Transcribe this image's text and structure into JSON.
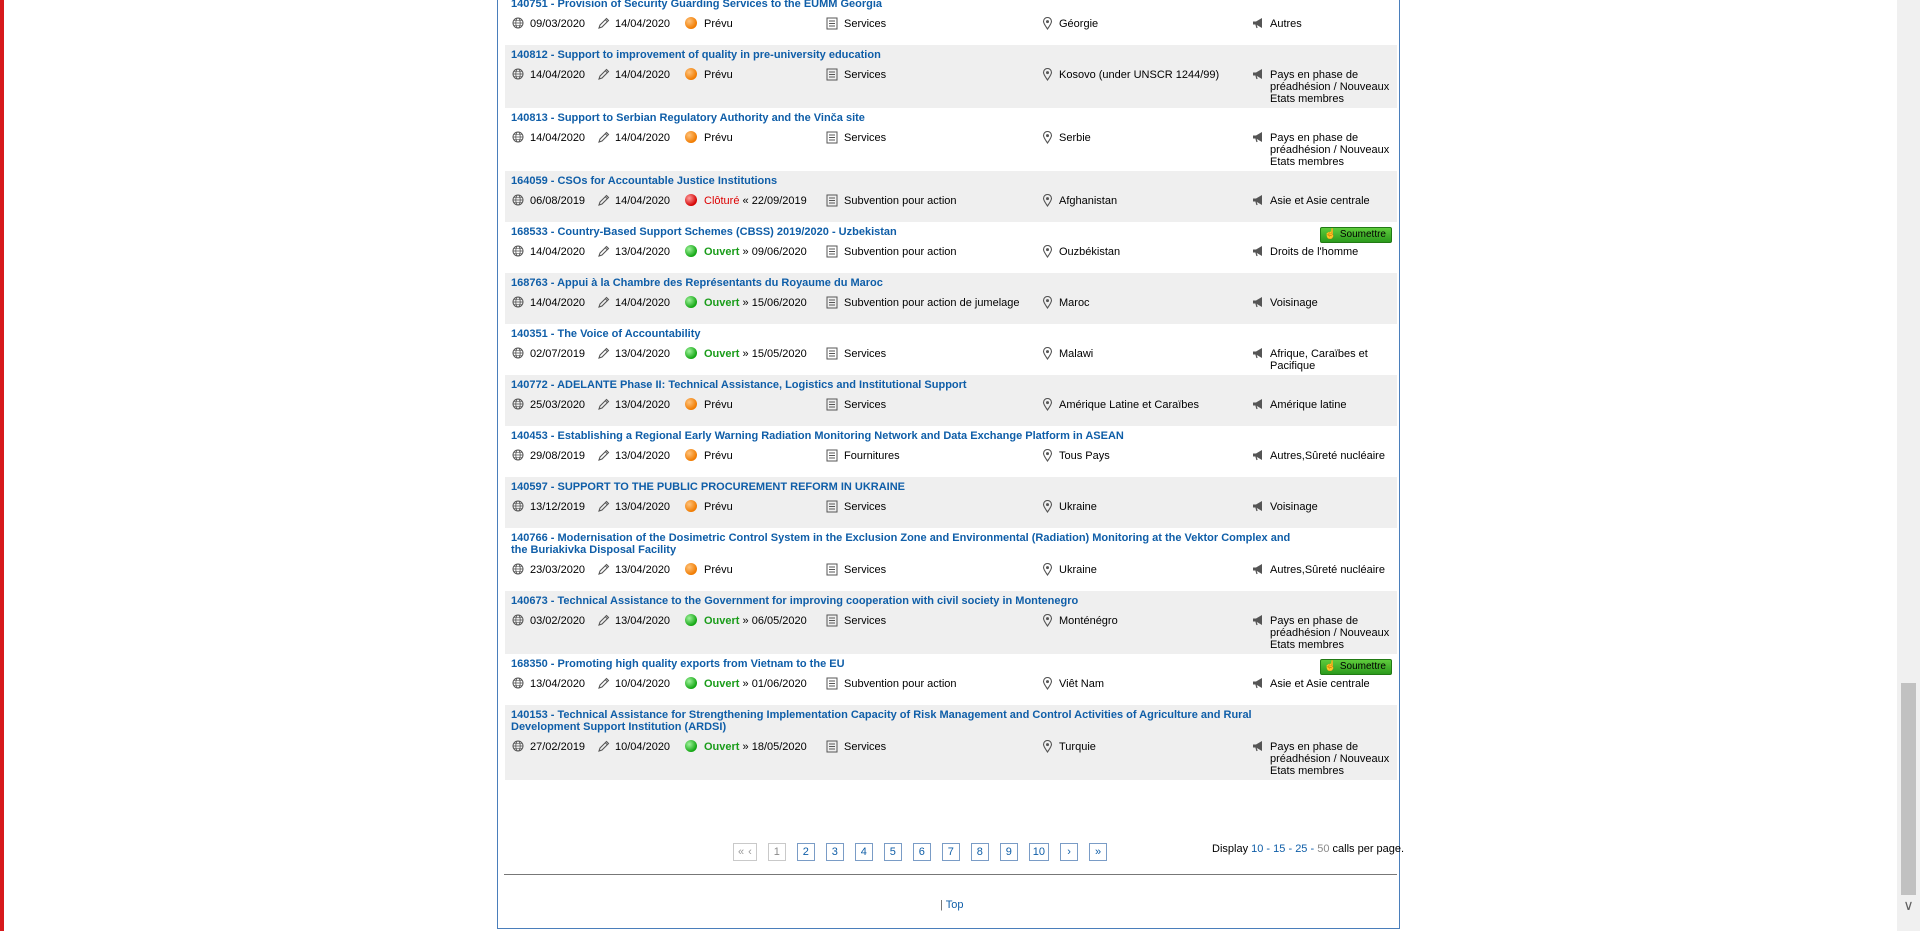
{
  "results": [
    {
      "title": "140751 - Provision of Security Guarding Services to the EUMM Georgia",
      "published": "09/03/2020",
      "modified": "14/04/2020",
      "status": "Prévu",
      "status_kind": "prevu",
      "deadline_prefix": "",
      "deadline": "",
      "type": "Services",
      "country": "Géorgie",
      "region": "Autres",
      "submit": ""
    },
    {
      "title": "140812 - Support to improvement of quality in pre-university education",
      "published": "14/04/2020",
      "modified": "14/04/2020",
      "status": "Prévu",
      "status_kind": "prevu",
      "deadline_prefix": "",
      "deadline": "",
      "type": "Services",
      "country": "Kosovo (under UNSCR 1244/99)",
      "region": "Pays en phase de préadhésion / Nouveaux Etats membres",
      "submit": ""
    },
    {
      "title": "140813 - Support to Serbian Regulatory Authority and the Vinča site",
      "published": "14/04/2020",
      "modified": "14/04/2020",
      "status": "Prévu",
      "status_kind": "prevu",
      "deadline_prefix": "",
      "deadline": "",
      "type": "Services",
      "country": "Serbie",
      "region": "Pays en phase de préadhésion / Nouveaux Etats membres",
      "submit": ""
    },
    {
      "title": "164059 - CSOs for Accountable Justice Institutions",
      "published": "06/08/2019",
      "modified": "14/04/2020",
      "status": "Clôturé",
      "status_kind": "cloture",
      "deadline_prefix": "«",
      "deadline": "22/09/2019",
      "type": "Subvention pour action",
      "country": "Afghanistan",
      "region": "Asie et Asie centrale",
      "submit": ""
    },
    {
      "title": "168533 - Country-Based Support Schemes (CBSS) 2019/2020 - Uzbekistan",
      "published": "14/04/2020",
      "modified": "13/04/2020",
      "status": "Ouvert",
      "status_kind": "ouvert",
      "deadline_prefix": "»",
      "deadline": "09/06/2020",
      "type": "Subvention pour action",
      "country": "Ouzbékistan",
      "region": "Droits de l'homme",
      "submit": "Soumettre"
    },
    {
      "title": "168763 - Appui à la Chambre des Représentants du Royaume du Maroc",
      "published": "14/04/2020",
      "modified": "14/04/2020",
      "status": "Ouvert",
      "status_kind": "ouvert",
      "deadline_prefix": "»",
      "deadline": "15/06/2020",
      "type": "Subvention pour action de jumelage",
      "country": "Maroc",
      "region": "Voisinage",
      "submit": ""
    },
    {
      "title": "140351 - The Voice of Accountability",
      "published": "02/07/2019",
      "modified": "13/04/2020",
      "status": "Ouvert",
      "status_kind": "ouvert",
      "deadline_prefix": "»",
      "deadline": "15/05/2020",
      "type": "Services",
      "country": "Malawi",
      "region": "Afrique, Caraïbes et Pacifique",
      "submit": ""
    },
    {
      "title": "140772 - ADELANTE Phase II: Technical Assistance, Logistics and Institutional Support",
      "published": "25/03/2020",
      "modified": "13/04/2020",
      "status": "Prévu",
      "status_kind": "prevu",
      "deadline_prefix": "",
      "deadline": "",
      "type": "Services",
      "country": "Amérique Latine et Caraïbes",
      "region": "Amérique latine",
      "submit": ""
    },
    {
      "title": "140453 - Establishing a Regional Early Warning Radiation Monitoring Network and Data Exchange Platform in ASEAN",
      "published": "29/08/2019",
      "modified": "13/04/2020",
      "status": "Prévu",
      "status_kind": "prevu",
      "deadline_prefix": "",
      "deadline": "",
      "type": "Fournitures",
      "country": "Tous Pays",
      "region": "Autres,Sûreté nucléaire",
      "submit": ""
    },
    {
      "title": "140597 - SUPPORT TO THE PUBLIC PROCUREMENT REFORM IN UKRAINE",
      "published": "13/12/2019",
      "modified": "13/04/2020",
      "status": "Prévu",
      "status_kind": "prevu",
      "deadline_prefix": "",
      "deadline": "",
      "type": "Services",
      "country": "Ukraine",
      "region": "Voisinage",
      "submit": ""
    },
    {
      "title": "140766 - Modernisation of the Dosimetric Control System in the Exclusion Zone and Environmental (Radiation) Monitoring at the Vektor Complex and the Buriakivka Disposal Facility",
      "published": "23/03/2020",
      "modified": "13/04/2020",
      "status": "Prévu",
      "status_kind": "prevu",
      "deadline_prefix": "",
      "deadline": "",
      "type": "Services",
      "country": "Ukraine",
      "region": "Autres,Sûreté nucléaire",
      "submit": ""
    },
    {
      "title": "140673 - Technical Assistance to the Government for improving cooperation with civil society in Montenegro",
      "published": "03/02/2020",
      "modified": "13/04/2020",
      "status": "Ouvert",
      "status_kind": "ouvert",
      "deadline_prefix": "»",
      "deadline": "06/05/2020",
      "type": "Services",
      "country": "Monténégro",
      "region": "Pays en phase de préadhésion / Nouveaux Etats membres",
      "submit": ""
    },
    {
      "title": "168350 - Promoting high quality exports from Vietnam to the EU",
      "published": "13/04/2020",
      "modified": "10/04/2020",
      "status": "Ouvert",
      "status_kind": "ouvert",
      "deadline_prefix": "»",
      "deadline": "01/06/2020",
      "type": "Subvention pour action",
      "country": "Viêt Nam",
      "region": "Asie et Asie centrale",
      "submit": "Soumettre"
    },
    {
      "title": "140153 - Technical Assistance for Strengthening Implementation Capacity of Risk Management and Control Activities of Agriculture and Rural Development Support Institution (ARDSI)",
      "published": "27/02/2019",
      "modified": "10/04/2020",
      "status": "Ouvert",
      "status_kind": "ouvert",
      "deadline_prefix": "»",
      "deadline": "18/05/2020",
      "type": "Services",
      "country": "Turquie",
      "region": "Pays en phase de préadhésion / Nouveaux Etats membres",
      "submit": ""
    }
  ],
  "pagination": {
    "first": "«",
    "prev": "‹",
    "pages": [
      "1",
      "2",
      "3",
      "4",
      "5",
      "6",
      "7",
      "8",
      "9",
      "10"
    ],
    "current": "1",
    "next": "›",
    "last": "»"
  },
  "display": {
    "prefix": "Display ",
    "options": [
      "10",
      "15",
      "25",
      "50"
    ],
    "current": "50",
    "separator": " - ",
    "suffix": " calls per page."
  },
  "footer": {
    "pipe": "| ",
    "top": "Top"
  },
  "icons": {
    "published": "globe-icon",
    "modified": "pencil-icon",
    "type": "document-stack-icon",
    "country": "location-icon",
    "region": "megaphone-icon",
    "submit": "hand-pointer-icon"
  },
  "colors": {
    "link": "#0f5ea8",
    "open": "#1a9c1a",
    "closed": "#dd0000",
    "planned_dot": "#f07b00",
    "alt_row": "#efefef",
    "submit_button": "#3cb52a"
  }
}
